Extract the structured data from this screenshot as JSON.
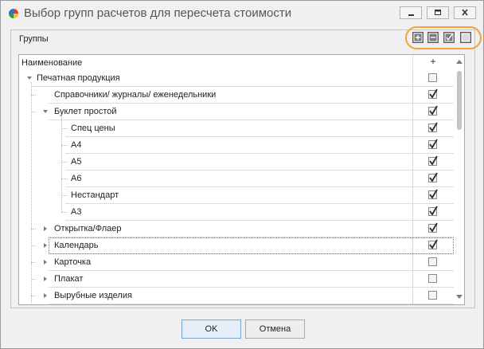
{
  "window": {
    "title": "Выбор групп расчетов для пересчета стоимости",
    "icons": {
      "app": "color-pinwheel-icon",
      "minimize": "minimize-icon",
      "maximize": "maximize-icon",
      "close": "close-icon"
    }
  },
  "panel": {
    "title": "Группы",
    "toolbar": [
      {
        "name": "expand-all",
        "icon": "plus-square-icon"
      },
      {
        "name": "collapse-all",
        "icon": "minus-square-icon"
      },
      {
        "name": "check-all",
        "icon": "checkmark-square-icon"
      },
      {
        "name": "uncheck-all",
        "icon": "filled-square-icon"
      }
    ],
    "highlight_color": "#f5a03c"
  },
  "grid": {
    "columns": {
      "name": "Наименование",
      "checked": "+"
    },
    "rows": [
      {
        "label": "Печатная продукция",
        "level": 0,
        "expander": "expanded",
        "checked": false
      },
      {
        "label": "Справочники/ журналы/ еженедельники",
        "level": 1,
        "expander": "none",
        "checked": true
      },
      {
        "label": "Буклет простой",
        "level": 1,
        "expander": "expanded",
        "checked": true
      },
      {
        "label": "Спец цены",
        "level": 2,
        "expander": "none",
        "checked": true
      },
      {
        "label": "А4",
        "level": 2,
        "expander": "none",
        "checked": true
      },
      {
        "label": "А5",
        "level": 2,
        "expander": "none",
        "checked": true
      },
      {
        "label": "А6",
        "level": 2,
        "expander": "none",
        "checked": true
      },
      {
        "label": "Нестандарт",
        "level": 2,
        "expander": "none",
        "checked": true
      },
      {
        "label": "А3",
        "level": 2,
        "expander": "none",
        "checked": true
      },
      {
        "label": "Открытка/Флаер",
        "level": 1,
        "expander": "collapsed",
        "checked": true
      },
      {
        "label": "Календарь",
        "level": 1,
        "expander": "collapsed",
        "checked": true,
        "focused": true
      },
      {
        "label": "Карточка",
        "level": 1,
        "expander": "collapsed",
        "checked": false
      },
      {
        "label": "Плакат",
        "level": 1,
        "expander": "collapsed",
        "checked": false
      },
      {
        "label": "Вырубные изделия",
        "level": 1,
        "expander": "collapsed",
        "checked": false
      }
    ]
  },
  "buttons": {
    "ok": "OK",
    "cancel": "Отмена"
  }
}
